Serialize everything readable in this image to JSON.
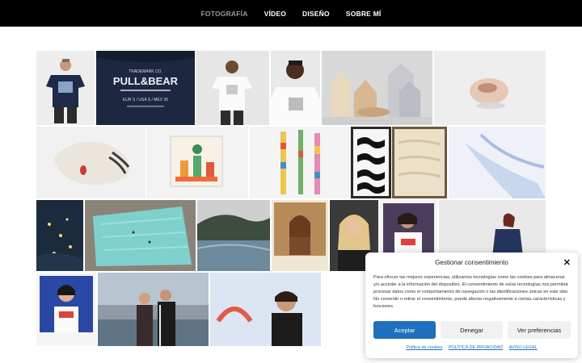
{
  "nav": {
    "items": [
      "FOTOGRAFÍA",
      "VÍDEO",
      "DISEÑO",
      "SOBRE MÍ"
    ],
    "active_index": 0
  },
  "gallery": {
    "tiles": [
      {
        "name": "tshirt-model-photo",
        "icon": "photo-icon"
      },
      {
        "name": "pull-and-bear-label-photo",
        "icon": "photo-icon",
        "text_lines": [
          "TRADEMARK CO.",
          "PULL&BEAR",
          "EUR S / USA S / MEX 36"
        ]
      },
      {
        "name": "white-tshirt-photo",
        "icon": "photo-icon"
      },
      {
        "name": "young-man-tshirt-photo",
        "icon": "photo-icon"
      },
      {
        "name": "wooden-houses-sculpture-photo",
        "icon": "photo-icon"
      },
      {
        "name": "ceramic-sculpture-photo",
        "icon": "photo-icon"
      },
      {
        "name": "white-ceramic-head-photo",
        "icon": "photo-icon"
      },
      {
        "name": "plant-illustration-frame-photo",
        "icon": "photo-icon"
      },
      {
        "name": "totem-figures-photo",
        "icon": "photo-icon"
      },
      {
        "name": "black-waves-print-photo",
        "icon": "photo-icon"
      },
      {
        "name": "sand-texture-print-photo",
        "icon": "photo-icon"
      },
      {
        "name": "blue-abstract-photo",
        "icon": "photo-icon"
      },
      {
        "name": "night-lights-photo",
        "icon": "photo-icon"
      },
      {
        "name": "pool-aerial-photo",
        "icon": "photo-icon"
      },
      {
        "name": "lake-landscape-photo",
        "icon": "photo-icon"
      },
      {
        "name": "woman-portrait-photo",
        "icon": "photo-icon"
      },
      {
        "name": "blonde-portrait-photo",
        "icon": "photo-icon"
      },
      {
        "name": "woman-tshirt-portrait-photo",
        "icon": "photo-icon"
      },
      {
        "name": "woman-jacket-outdoor-photo",
        "icon": "photo-icon"
      },
      {
        "name": "girl-blue-background-photo",
        "icon": "photo-icon"
      },
      {
        "name": "couple-harbour-photo",
        "icon": "photo-icon"
      },
      {
        "name": "man-poster-portrait-photo",
        "icon": "photo-icon"
      }
    ]
  },
  "cookie": {
    "title": "Gestionar consentimiento",
    "close_icon": "close-icon",
    "body": "Para ofrecer las mejores experiencias, utilizamos tecnologías como las cookies para almacenar y/o acceder a la información del dispositivo. El consentimiento de estas tecnologías nos permitirá procesar datos como el comportamiento de navegación o las identificaciones únicas en este sitio. No consentir o retirar el consentimiento, puede afectar negativamente a ciertas características y funciones.",
    "accept": "Aceptar",
    "deny": "Denegar",
    "preferences": "Ver preferencias",
    "links": [
      "Política de cookies",
      "POLÍTICA DE PRIVACIDAD",
      "AVISO LEGAL"
    ]
  },
  "colors": {
    "nav_bg": "#000000",
    "nav_active": "#9a9a9a",
    "accent": "#1e6fbe"
  }
}
